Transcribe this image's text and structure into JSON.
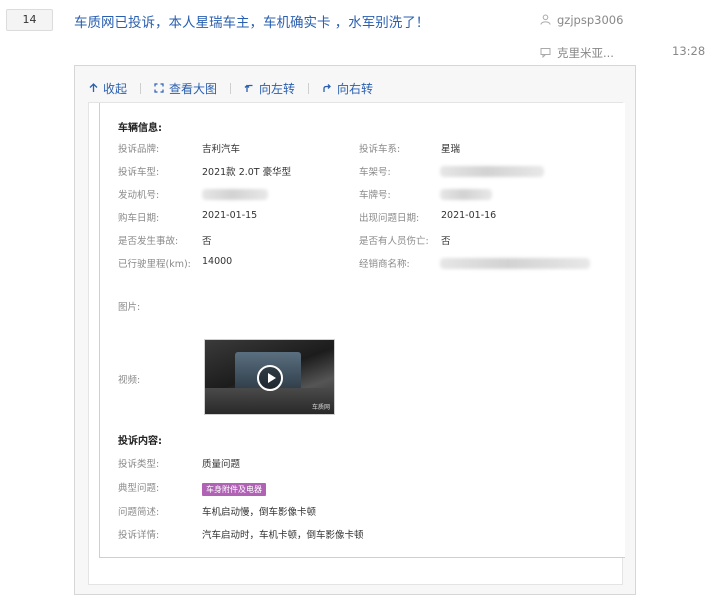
{
  "thread": {
    "reply_count": "14",
    "title": "车质网已投诉，本人星瑞车主，车机确实卡 ，水军别洗了！",
    "author": "gzjpsp3006",
    "last_poster": "克里米亚...",
    "last_time": "13:28"
  },
  "toolbar": {
    "collapse": "收起",
    "view_large": "查看大图",
    "rotate_left": "向左转",
    "rotate_right": "向右转"
  },
  "icons": {
    "author": "user-icon",
    "last_reply": "comment-icon",
    "collapse": "arrow-up-icon",
    "view_large": "expand-icon",
    "rotate_left": "rotate-left-icon",
    "rotate_right": "rotate-right-icon",
    "video": "play-icon"
  },
  "colors": {
    "link_blue": "#2a5fb0",
    "tag_purple": "#b062b5"
  },
  "document": {
    "vehicle_section": "车辆信息:",
    "brand_label": "投诉品牌:",
    "brand_value": "吉利汽车",
    "series_label": "投诉车系:",
    "series_value": "星瑞",
    "model_label": "投诉车型:",
    "model_value": "2021款 2.0T 豪华型",
    "vin_label": "车架号:",
    "engine_label": "发动机号:",
    "plate_label": "车牌号:",
    "purchase_date_label": "购车日期:",
    "purchase_date_value": "2021-01-15",
    "issue_date_label": "出现问题日期:",
    "issue_date_value": "2021-01-16",
    "accident_label": "是否发生事故:",
    "accident_value": "否",
    "injury_label": "是否有人员伤亡:",
    "injury_value": "否",
    "mileage_label": "已行驶里程(km):",
    "mileage_value": "14000",
    "dealer_label": "经销商名称:",
    "images_label": "图片:",
    "video_label": "视频:",
    "video_watermark": "车质网",
    "complaint_section": "投诉内容:",
    "type_label": "投诉类型:",
    "type_value": "质量问题",
    "typical_label": "典型问题:",
    "typical_tag": "车身附件及电器",
    "brief_label": "问题简述:",
    "brief_value": "车机启动慢，倒车影像卡顿",
    "detail_label": "投诉详情:",
    "detail_value": "汽车启动时，车机卡顿，倒车影像卡顿"
  }
}
